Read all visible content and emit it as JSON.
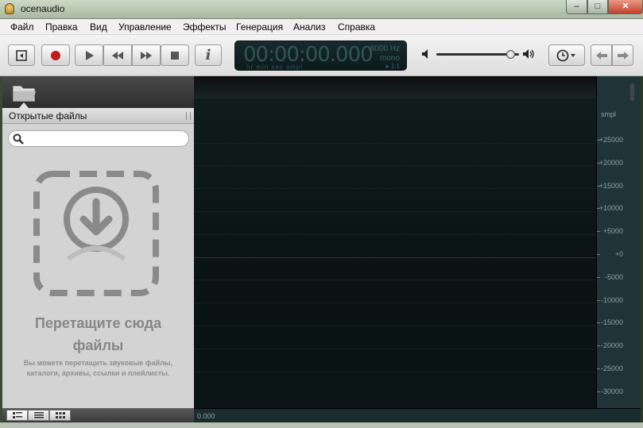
{
  "window": {
    "title": "ocenaudio",
    "min": "–",
    "max": "□",
    "close": "✕"
  },
  "menu": [
    "Файл",
    "Правка",
    "Вид",
    "Управление",
    "Эффекты",
    "Генерация",
    "Анализ",
    "Справка"
  ],
  "toolbar": {
    "info_label": "i",
    "time": "00:00:00.000",
    "time_units": "hr  min sec  smpl",
    "sample_rate": "8000 Hz",
    "channels": "mono",
    "mini_status": "▸ 1:1",
    "volume": 0.9
  },
  "left_panel": {
    "header": "Открытые файлы",
    "search_placeholder": "",
    "drop_title_line1": "Перетащите сюда",
    "drop_title_line2": "файлы",
    "drop_sub": "Вы можете перетащить звуковые файлы, каталоги, архивы, ссылки и плейлисты."
  },
  "scale": {
    "unit": "smpl",
    "labels": [
      "+25000",
      "+20000",
      "+15000",
      "+10000",
      "+5000",
      "+0",
      "-5000",
      "-10000",
      "-15000",
      "-20000",
      "-25000",
      "-30000"
    ]
  },
  "time_axis": {
    "start": "0.000"
  },
  "colors": {
    "record": "#c21a1a",
    "waveform_bg": "#0a1414",
    "center_line": "#5a1e1e"
  }
}
